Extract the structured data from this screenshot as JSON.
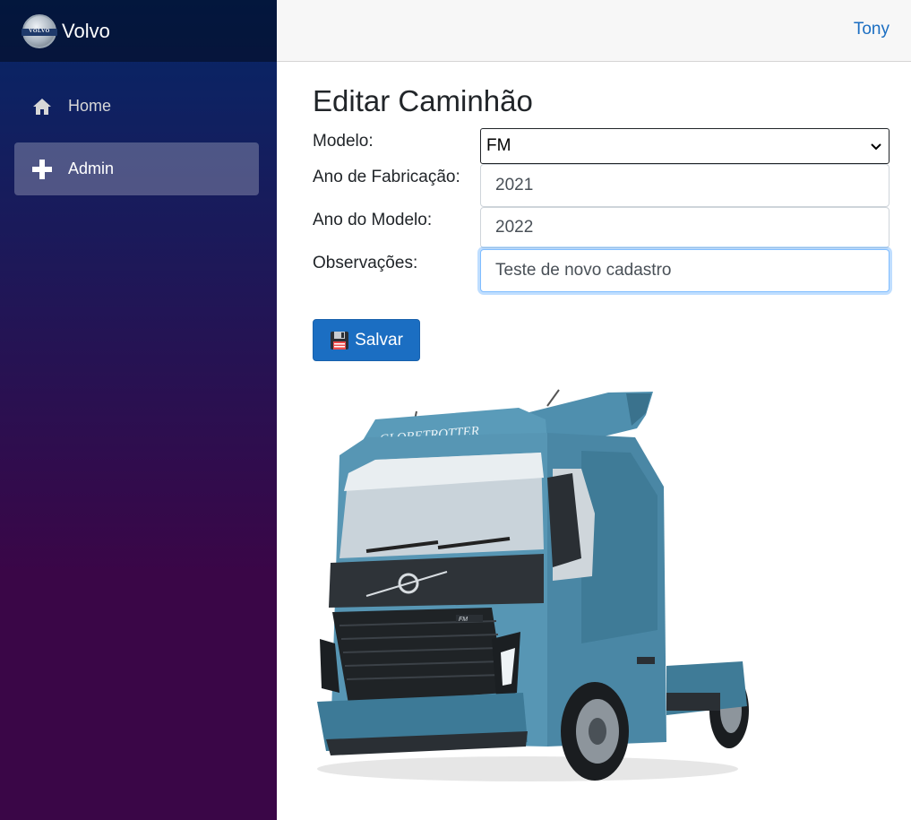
{
  "brand": {
    "name": "Volvo",
    "logo_text": "VOLVO"
  },
  "sidebar": {
    "items": [
      {
        "label": "Home",
        "icon": "home-icon",
        "active": false
      },
      {
        "label": "Admin",
        "icon": "plus-icon",
        "active": true
      }
    ]
  },
  "topbar": {
    "user": "Tony"
  },
  "page": {
    "title": "Editar Caminhão"
  },
  "form": {
    "modelo": {
      "label": "Modelo:",
      "value": "FM"
    },
    "ano_fabricacao": {
      "label": "Ano de Fabricação:",
      "value": "2021"
    },
    "ano_modelo": {
      "label": "Ano do Modelo:",
      "value": "2022"
    },
    "observacoes": {
      "label": "Observações:",
      "value": "Teste de novo cadastro"
    },
    "save_label": "Salvar"
  },
  "image": {
    "truck_lettering": "GLOBETROTTER",
    "truck_badge": "FM"
  },
  "colors": {
    "accent": "#1b6ec2",
    "sidebar_top": "#052767",
    "sidebar_bottom": "#3a0647",
    "truck_body": "#3f7f9c"
  }
}
